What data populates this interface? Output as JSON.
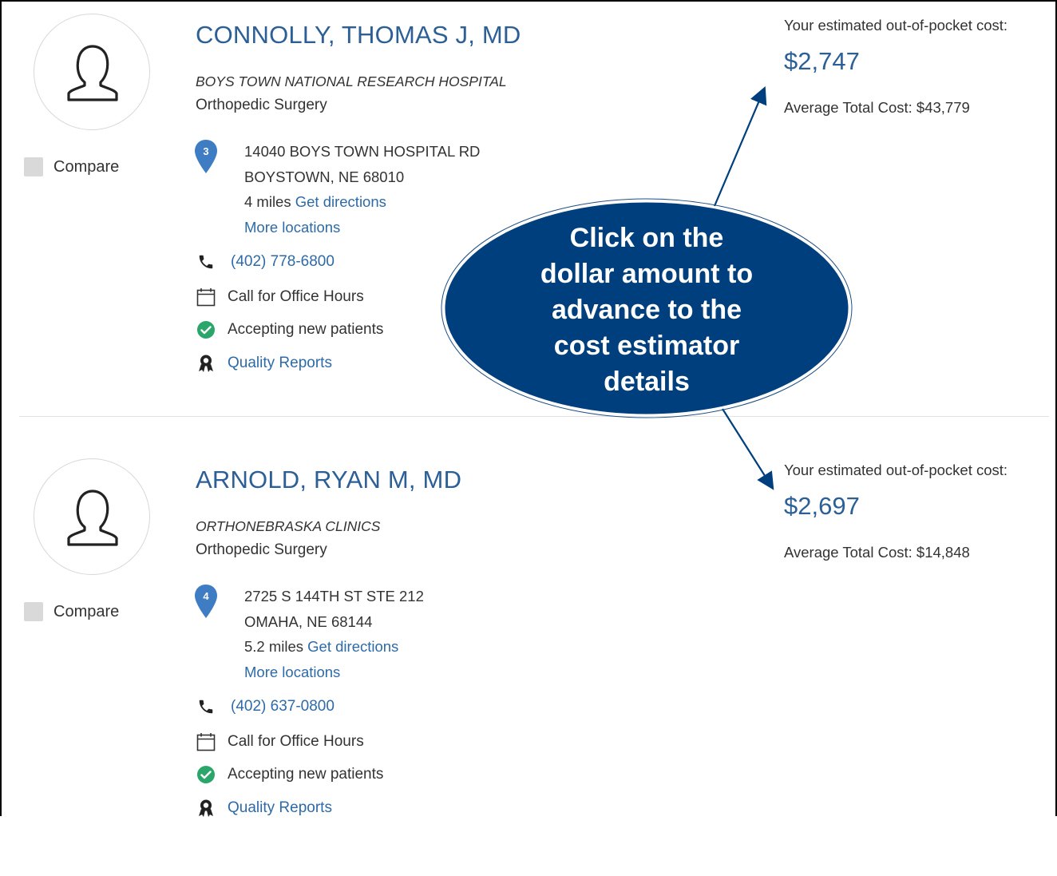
{
  "providers": [
    {
      "name": "CONNOLLY, THOMAS J, MD",
      "hospital": "BOYS TOWN NATIONAL RESEARCH HOSPITAL",
      "specialty": "Orthopedic Surgery",
      "compare_label": "Compare",
      "pin_number": "3",
      "address_line1": "14040 BOYS TOWN HOSPITAL RD",
      "address_line2": "BOYSTOWN, NE 68010",
      "distance": "4 miles",
      "directions_label": "Get directions",
      "more_locations": "More locations",
      "phone": "(402) 778-6800",
      "hours": "Call for Office Hours",
      "accepting": "Accepting new patients",
      "quality": "Quality Reports",
      "cost_label": "Your estimated out-of-pocket cost:",
      "cost_amount": "$2,747",
      "avg_total": "Average Total Cost: $43,779"
    },
    {
      "name": "ARNOLD, RYAN M, MD",
      "hospital": "ORTHONEBRASKA CLINICS",
      "specialty": "Orthopedic Surgery",
      "compare_label": "Compare",
      "pin_number": "4",
      "address_line1": "2725 S 144TH ST STE 212",
      "address_line2": "OMAHA, NE 68144",
      "distance": "5.2 miles",
      "directions_label": "Get directions",
      "more_locations": "More locations",
      "phone": "(402) 637-0800",
      "hours": "Call for Office Hours",
      "accepting": "Accepting new patients",
      "quality": "Quality Reports",
      "cost_label": "Your estimated out-of-pocket cost:",
      "cost_amount": "$2,697",
      "avg_total": "Average Total Cost: $14,848"
    }
  ],
  "callout": {
    "lines": [
      "Click on the",
      "dollar amount to",
      "advance to the",
      "cost estimator",
      "details"
    ],
    "fill_color": "#003f7d",
    "border_color": "#ffffff"
  },
  "icons": {
    "avatar": "person-silhouette-icon",
    "pin": "map-pin-icon",
    "phone": "phone-icon",
    "calendar": "calendar-icon",
    "check": "check-circle-icon",
    "award": "award-ribbon-icon"
  },
  "colors": {
    "provider_name": "#2c5f96",
    "link": "#2e6aa8",
    "pin": "#3e7cc4",
    "check": "#2aa66a"
  }
}
